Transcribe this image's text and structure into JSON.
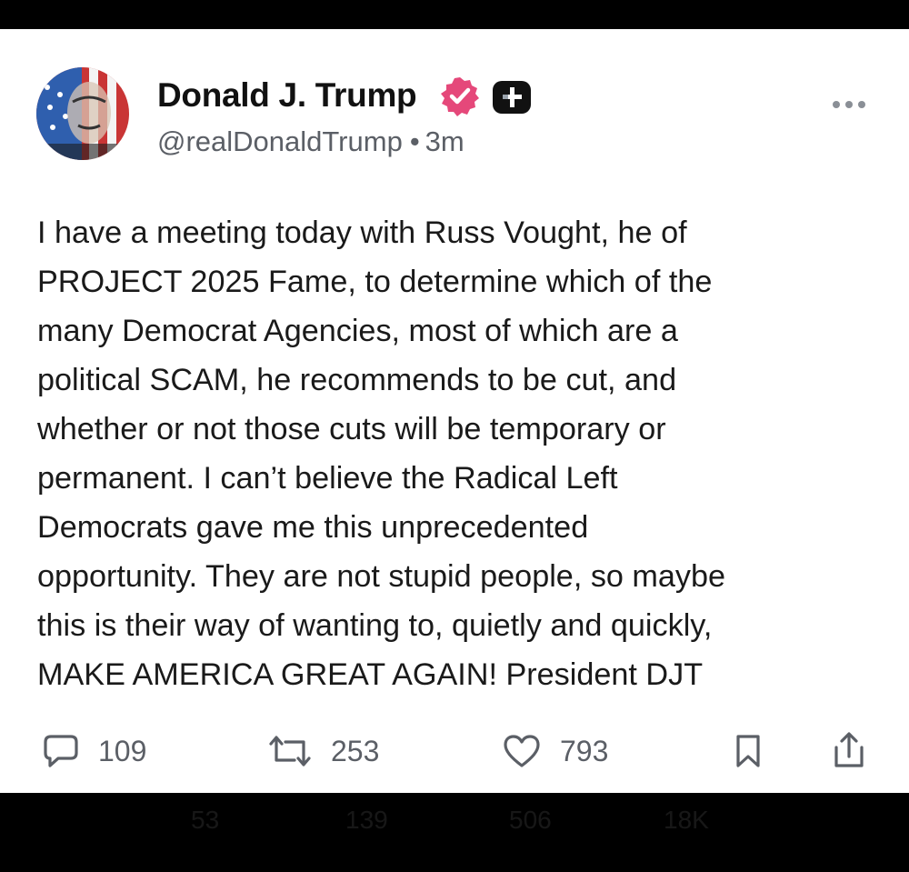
{
  "post": {
    "author": {
      "name": "Donald J. Trump",
      "handle": "@realDonaldTrump",
      "time": "3m"
    },
    "body_lines": [
      "I have a meeting today with Russ Vought, he of",
      "PROJECT 2025 Fame, to determine which of the",
      "many Democrat Agencies, most of which are a",
      "political SCAM, he recommends to be cut, and",
      "whether or not those cuts will be temporary or",
      "permanent. I can’t believe the Radical Left",
      "Democrats gave me this unprecedented",
      "opportunity. They are not stupid people, so maybe",
      "this is their way of wanting to, quietly and quickly,",
      "MAKE AMERICA GREAT AGAIN! President DJT"
    ],
    "stats": {
      "replies": "109",
      "reposts": "253",
      "likes": "793"
    }
  },
  "ghost_stats": {
    "replies": "53",
    "reposts": "139",
    "likes": "506",
    "views": "18K"
  },
  "icons": {
    "verified": "verified-badge-icon",
    "plus": "plus-badge-icon",
    "more": "more-dots-icon",
    "reply": "reply-icon",
    "repost": "repost-icon",
    "like": "like-icon",
    "bookmark": "bookmark-icon",
    "share": "share-icon"
  },
  "colors": {
    "verified_badge": "#e5487a",
    "text": "#1a1a1a",
    "muted": "#5b5f66"
  }
}
